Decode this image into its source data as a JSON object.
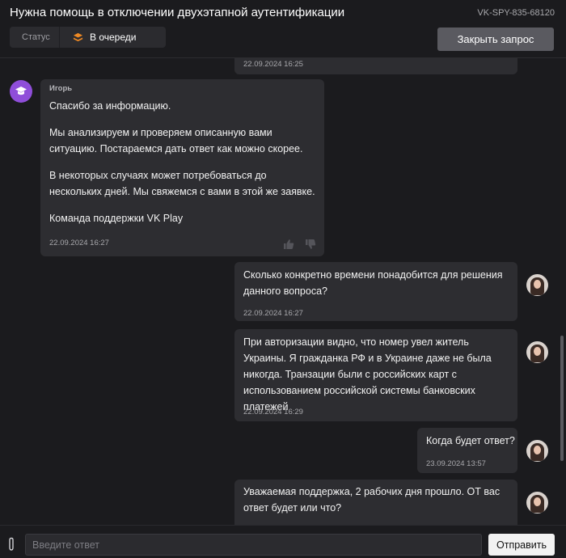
{
  "header": {
    "title": "Нужна помощь в отключении двухэтапной аутентификации",
    "ticket_id": "VK-SPY-835-68120",
    "status_label": "Статус",
    "status_value": "В очереди",
    "close_button": "Закрыть запрос"
  },
  "messages": [
    {
      "time": "22.09.2024 16:25"
    },
    {
      "author": "Игорь",
      "paragraphs": [
        "Спасибо за информацию.",
        "Мы анализируем и проверяем описанную вами ситуацию. Постараемся дать ответ как можно скорее.",
        "В некоторых случаях может потребоваться до нескольких дней. Мы свяжемся с вами в этой же заявке.",
        "Команда поддержки VK Play"
      ],
      "time": "22.09.2024 16:27"
    },
    {
      "text": "Сколько конкретно времени понадобится для решения данного вопроса?",
      "time": "22.09.2024 16:27"
    },
    {
      "text": "При авторизации видно, что номер увел житель Украины. Я гражданка РФ и в Украине даже не была никогда. Транзации были с российских карт с использованием российской системы банковских платежей",
      "time": "22.09.2024 16:29"
    },
    {
      "text": "Когда будет ответ?",
      "time": "23.09.2024 13:57"
    },
    {
      "text": "Уважаемая поддержка, 2 рабочих дня прошло. ОТ вас ответ будет или что?"
    }
  ],
  "composer": {
    "placeholder": "Введите ответ",
    "send_button": "Отправить"
  },
  "colors": {
    "accent_status": "#f08a24",
    "support_avatar": "#8f4ed9",
    "bubble": "#2d2d31",
    "background": "#1b1b1e"
  }
}
